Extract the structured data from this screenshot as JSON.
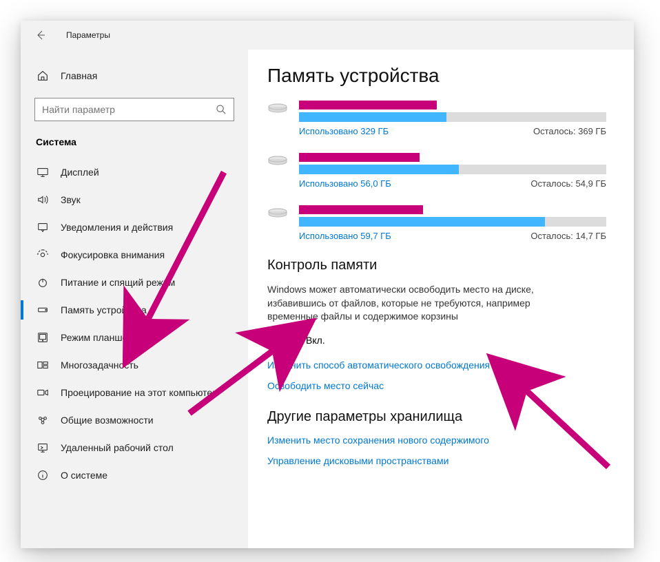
{
  "window": {
    "title": "Параметры"
  },
  "sidebar": {
    "home": "Главная",
    "search_placeholder": "Найти параметр",
    "section": "Система",
    "items": [
      {
        "label": "Дисплей",
        "icon": "display",
        "selected": false
      },
      {
        "label": "Звук",
        "icon": "sound",
        "selected": false
      },
      {
        "label": "Уведомления и действия",
        "icon": "notifications",
        "selected": false
      },
      {
        "label": "Фокусировка внимания",
        "icon": "focus",
        "selected": false
      },
      {
        "label": "Питание и спящий режим",
        "icon": "power",
        "selected": false
      },
      {
        "label": "Память устройства",
        "icon": "storage",
        "selected": true
      },
      {
        "label": "Режим планшета",
        "icon": "tablet",
        "selected": false
      },
      {
        "label": "Многозадачность",
        "icon": "multitask",
        "selected": false
      },
      {
        "label": "Проецирование на этот компьютер",
        "icon": "project",
        "selected": false
      },
      {
        "label": "Общие возможности",
        "icon": "shared",
        "selected": false
      },
      {
        "label": "Удаленный рабочий стол",
        "icon": "remote",
        "selected": false
      },
      {
        "label": "О системе",
        "icon": "about",
        "selected": false
      }
    ]
  },
  "page": {
    "title": "Память устройства",
    "drives": [
      {
        "redact_width": 200,
        "fill_pct": 48,
        "used_text": "Использовано 329 ГБ",
        "free_text": "Осталось: 369 ГБ"
      },
      {
        "redact_width": 175,
        "fill_pct": 52,
        "used_text": "Использовано 56,0 ГБ",
        "free_text": "Осталось: 54,9 ГБ"
      },
      {
        "redact_width": 180,
        "fill_pct": 80,
        "used_text": "Использовано 59,7 ГБ",
        "free_text": "Осталось: 14,7 ГБ"
      }
    ],
    "storage_sense": {
      "heading": "Контроль памяти",
      "desc": "Windows может автоматически освободить место на диске, избавившись от файлов, которые не требуются, например временные файлы и содержимое корзины",
      "state_label": "Вкл.",
      "enabled": true,
      "link_configure": "Изменить способ автоматического освобождения места",
      "link_free_now": "Освободить место сейчас"
    },
    "other": {
      "heading": "Другие параметры хранилища",
      "link_locations": "Изменить место сохранения нового содержимого",
      "link_spaces": "Управление дисковыми пространствами"
    }
  }
}
